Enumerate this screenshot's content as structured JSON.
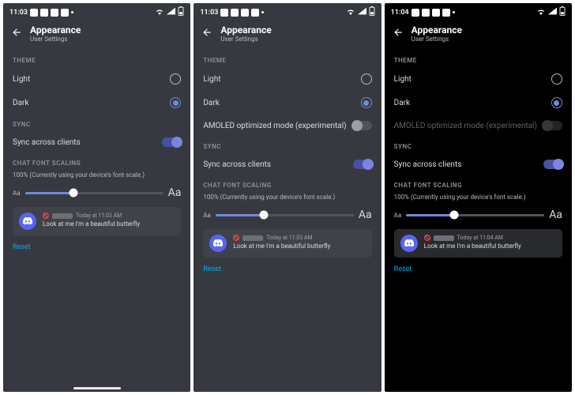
{
  "panes": [
    {
      "bg": "bg-dark",
      "status": {
        "time": "11:03"
      },
      "header": {
        "title": "Appearance",
        "subtitle": "User Settings"
      },
      "theme": {
        "label": "THEME",
        "light": "Light",
        "dark": "Dark",
        "selected": "dark",
        "amoled": null
      },
      "sync": {
        "label": "SYNC",
        "item": "Sync across clients",
        "on": true
      },
      "scaling": {
        "label": "CHAT FONT SCALING",
        "desc": "100% (Currently using your device's font scale.)",
        "aa_small": "Aa",
        "aa_large": "Aa",
        "percent": 35
      },
      "preview": {
        "timestamp": "Today at 11:03 AM",
        "text": "Look at me I'm a beautiful butterfly"
      },
      "reset": "Reset",
      "home_indicator": true
    },
    {
      "bg": "bg-dark",
      "status": {
        "time": "11:03"
      },
      "header": {
        "title": "Appearance",
        "subtitle": "User Settings"
      },
      "theme": {
        "label": "THEME",
        "light": "Light",
        "dark": "Dark",
        "selected": "dark",
        "amoled": {
          "label": "AMOLED optimized mode (experimental)",
          "state": "off-grey",
          "disabled": false
        }
      },
      "sync": {
        "label": "SYNC",
        "item": "Sync across clients",
        "on": true
      },
      "scaling": {
        "label": "CHAT FONT SCALING",
        "desc": "100% (Currently using your device's font scale.)",
        "aa_small": "Aa",
        "aa_large": "Aa",
        "percent": 35
      },
      "preview": {
        "timestamp": "Today at 11:03 AM",
        "text": "Look at me I'm a beautiful butterfly"
      },
      "reset": "Reset",
      "home_indicator": false
    },
    {
      "bg": "bg-black",
      "status": {
        "time": "11:04"
      },
      "header": {
        "title": "Appearance",
        "subtitle": "User Settings"
      },
      "theme": {
        "label": "THEME",
        "light": "Light",
        "dark": "Dark",
        "selected": "dark",
        "amoled": {
          "label": "AMOLED optimized mode (experimental)",
          "state": "off-dark",
          "disabled": true
        }
      },
      "sync": {
        "label": "SYNC",
        "item": "Sync across clients",
        "on": true
      },
      "scaling": {
        "label": "CHAT FONT SCALING",
        "desc": "100% (Currently using your device's font scale.)",
        "aa_small": "Aa",
        "aa_large": "Aa",
        "percent": 35
      },
      "preview": {
        "timestamp": "Today at 11:04 AM",
        "text": "Look at me I'm a beautiful butterfly"
      },
      "reset": "Reset",
      "home_indicator": false
    }
  ],
  "status_icons": [
    "tiktok-icon",
    "snapchat-icon",
    "tiktok-icon",
    "youtube-icon",
    "dot-icon"
  ],
  "status_right_icons": [
    "wifi-icon",
    "signal-icon",
    "battery-icon"
  ]
}
